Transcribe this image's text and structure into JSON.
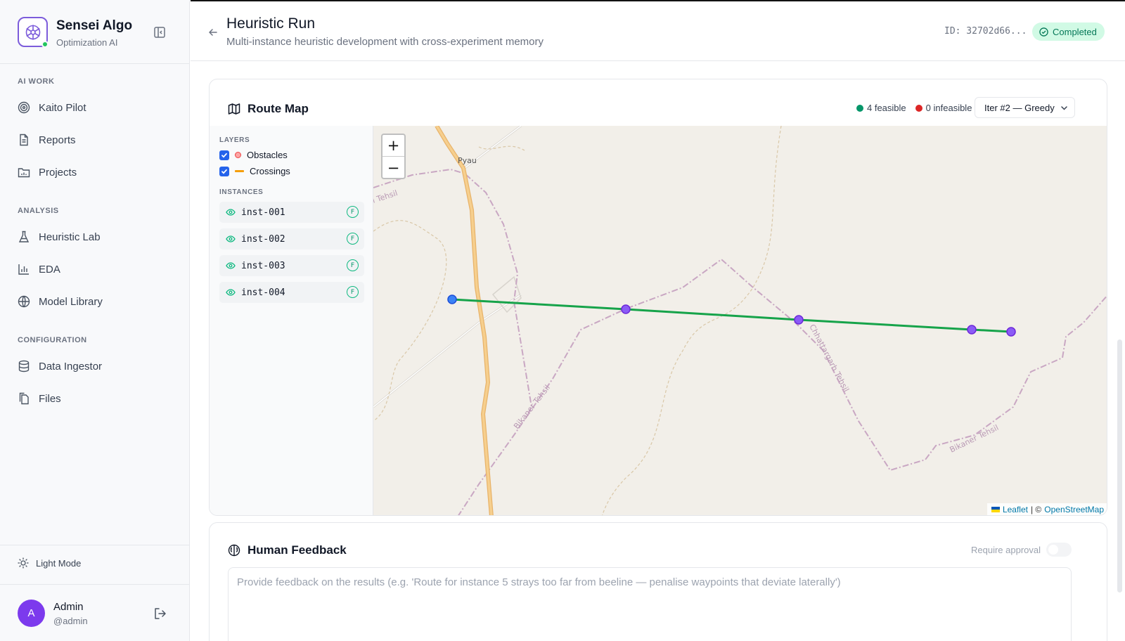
{
  "brand": {
    "name": "Sensei Algo",
    "subtitle": "Optimization AI"
  },
  "sidebar": {
    "sections": [
      {
        "title": "AI WORK",
        "items": [
          {
            "label": "Kaito Pilot",
            "icon": "target-icon"
          },
          {
            "label": "Reports",
            "icon": "document-icon"
          },
          {
            "label": "Projects",
            "icon": "folder-chart-icon"
          }
        ]
      },
      {
        "title": "ANALYSIS",
        "items": [
          {
            "label": "Heuristic Lab",
            "icon": "flask-icon"
          },
          {
            "label": "EDA",
            "icon": "bar-chart-icon"
          },
          {
            "label": "Model Library",
            "icon": "globe-icon"
          }
        ]
      },
      {
        "title": "CONFIGURATION",
        "items": [
          {
            "label": "Data Ingestor",
            "icon": "database-icon"
          },
          {
            "label": "Files",
            "icon": "files-icon"
          }
        ]
      }
    ],
    "theme_toggle": "Light Mode",
    "user": {
      "initial": "A",
      "name": "Admin",
      "handle": "@admin"
    }
  },
  "header": {
    "title": "Heuristic Run",
    "subtitle": "Multi-instance heuristic development with cross-experiment memory",
    "run_id": "ID: 32702d66...",
    "status": "Completed"
  },
  "route_map": {
    "title": "Route Map",
    "feasible_label": "4 feasible",
    "infeasible_label": "0 infeasible",
    "iteration_selected": "Iter #2 — Greedy",
    "layers_title": "LAYERS",
    "layers": [
      {
        "label": "Obstacles",
        "checked": true
      },
      {
        "label": "Crossings",
        "checked": true
      }
    ],
    "instances_title": "INSTANCES",
    "instances": [
      {
        "id": "inst-001",
        "badge": "F"
      },
      {
        "id": "inst-002",
        "badge": "F"
      },
      {
        "id": "inst-003",
        "badge": "F"
      },
      {
        "id": "inst-004",
        "badge": "F"
      }
    ],
    "map_labels": {
      "pyau": "Pyau",
      "tehsil_left": "l Tehsil",
      "bikaner_1": "Bikaner Tehsil",
      "bikaner_2": "Bikaner Tehsil",
      "chhattargarh": "Chhattargarh Tehsil"
    },
    "zoom_in": "+",
    "zoom_out": "−",
    "attribution": {
      "leaflet": "Leaflet",
      "separator": "| ©",
      "osm": "OpenStreetMap"
    },
    "colors": {
      "feasible": "#059669",
      "infeasible": "#dc2626",
      "route": "#16a34a",
      "waypoint": "#8b5cf6",
      "start": "#3b82f6"
    }
  },
  "feedback": {
    "title": "Human Feedback",
    "require_approval": "Require approval",
    "require_approval_on": false,
    "placeholder": "Provide feedback on the results (e.g. 'Route for instance 5 strays too far from beeline — penalise waypoints that deviate laterally')"
  }
}
